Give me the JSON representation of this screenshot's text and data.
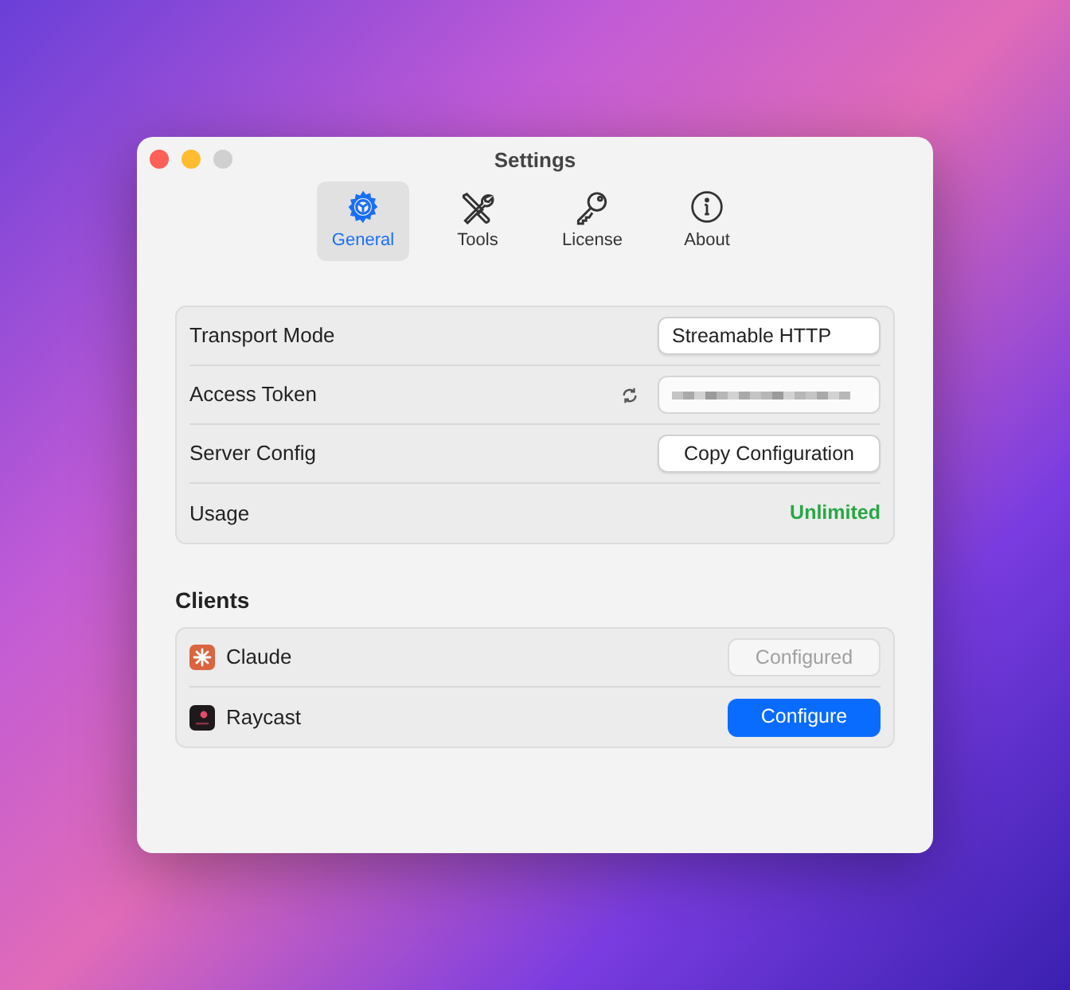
{
  "window": {
    "title": "Settings"
  },
  "tabs": [
    {
      "label": "General",
      "selected": true,
      "kind": "gear"
    },
    {
      "label": "Tools",
      "selected": false,
      "kind": "tools"
    },
    {
      "label": "License",
      "selected": false,
      "kind": "key"
    },
    {
      "label": "About",
      "selected": false,
      "kind": "info"
    }
  ],
  "settings": [
    {
      "kind": "popup",
      "label": "Transport Mode",
      "value": "Streamable HTTP"
    },
    {
      "kind": "token",
      "label": "Access Token"
    },
    {
      "kind": "button",
      "label": "Server Config",
      "value": "Copy Configuration"
    },
    {
      "kind": "status",
      "label": "Usage",
      "value": "Unlimited"
    }
  ],
  "clients_heading": "Clients",
  "clients": [
    {
      "name": "Claude",
      "kind": "claude",
      "button": "Configured",
      "disabled": true
    },
    {
      "name": "Raycast",
      "kind": "raycast",
      "button": "Configure",
      "disabled": false
    }
  ]
}
